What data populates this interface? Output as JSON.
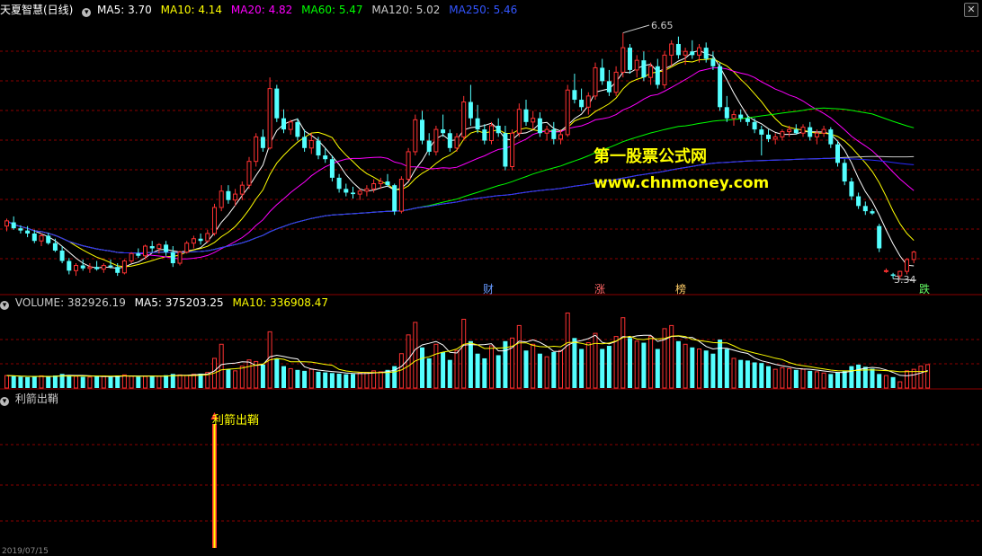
{
  "header": {
    "title": "天夏智慧(日线)",
    "ma_items": [
      {
        "label": "MA5: 3.70",
        "color": "#ffffff"
      },
      {
        "label": "MA10: 4.14",
        "color": "#ffff00"
      },
      {
        "label": "MA20: 4.82",
        "color": "#ff00ff"
      },
      {
        "label": "MA60: 5.47",
        "color": "#00ff00"
      },
      {
        "label": "MA120: 5.02",
        "color": "#cccccc"
      },
      {
        "label": "MA250: 5.46",
        "color": "#0000ff"
      }
    ]
  },
  "volume_header": {
    "items": [
      {
        "label": "VOLUME: 382926.19",
        "color": "#cccccc"
      },
      {
        "label": "MA5: 375203.25",
        "color": "#ffffff"
      },
      {
        "label": "MA10: 336908.47",
        "color": "#ffff00"
      }
    ]
  },
  "indicator_header": {
    "name": "利箭出鞘"
  },
  "watermark": {
    "line1": "第一股票公式网",
    "line2": "www.chnmoney.com"
  },
  "events": [
    {
      "label": "财",
      "color": "#6699ff"
    },
    {
      "label": "涨",
      "color": "#ff6666"
    },
    {
      "label": "榜",
      "color": "#ffcc66"
    },
    {
      "label": "跌",
      "color": "#66ff66"
    }
  ],
  "price_labels": {
    "high": "6.65",
    "low": "3.34"
  },
  "signal": {
    "label": "利箭出鞘"
  },
  "bottom_date": "2019/07/15",
  "chart_data": {
    "type": "candlestick",
    "colors": {
      "up": "#ff3232",
      "down": "#54ffff",
      "grid": "#8b0000",
      "signal": "#ffff00"
    },
    "ohlc": [
      [
        4.05,
        4.15,
        3.98,
        4.12
      ],
      [
        4.1,
        4.18,
        4.0,
        4.02
      ],
      [
        4.02,
        4.06,
        3.95,
        3.99
      ],
      [
        3.99,
        4.05,
        3.9,
        3.95
      ],
      [
        3.95,
        4.0,
        3.82,
        3.85
      ],
      [
        3.85,
        3.95,
        3.78,
        3.92
      ],
      [
        3.92,
        3.96,
        3.8,
        3.82
      ],
      [
        3.82,
        3.88,
        3.7,
        3.72
      ],
      [
        3.72,
        3.78,
        3.55,
        3.58
      ],
      [
        3.58,
        3.62,
        3.4,
        3.45
      ],
      [
        3.45,
        3.55,
        3.38,
        3.52
      ],
      [
        3.52,
        3.6,
        3.45,
        3.48
      ],
      [
        3.48,
        3.55,
        3.42,
        3.5
      ],
      [
        3.5,
        3.58,
        3.45,
        3.47
      ],
      [
        3.47,
        3.55,
        3.42,
        3.52
      ],
      [
        3.52,
        3.6,
        3.48,
        3.5
      ],
      [
        3.5,
        3.55,
        3.38,
        3.42
      ],
      [
        3.42,
        3.6,
        3.4,
        3.58
      ],
      [
        3.58,
        3.7,
        3.55,
        3.68
      ],
      [
        3.68,
        3.75,
        3.62,
        3.65
      ],
      [
        3.65,
        3.8,
        3.6,
        3.78
      ],
      [
        3.78,
        3.85,
        3.7,
        3.75
      ],
      [
        3.75,
        3.82,
        3.68,
        3.8
      ],
      [
        3.8,
        3.85,
        3.65,
        3.7
      ],
      [
        3.7,
        3.78,
        3.5,
        3.55
      ],
      [
        3.55,
        3.72,
        3.52,
        3.7
      ],
      [
        3.7,
        3.85,
        3.68,
        3.82
      ],
      [
        3.82,
        3.92,
        3.75,
        3.88
      ],
      [
        3.88,
        3.95,
        3.8,
        3.85
      ],
      [
        3.85,
        4.0,
        3.82,
        3.95
      ],
      [
        3.95,
        4.35,
        3.92,
        4.3
      ],
      [
        4.3,
        4.6,
        4.25,
        4.52
      ],
      [
        4.52,
        4.6,
        4.35,
        4.4
      ],
      [
        4.4,
        4.55,
        4.32,
        4.48
      ],
      [
        4.48,
        4.65,
        4.4,
        4.6
      ],
      [
        4.6,
        4.98,
        4.55,
        4.92
      ],
      [
        4.92,
        5.3,
        4.85,
        5.25
      ],
      [
        5.25,
        5.35,
        5.05,
        5.1
      ],
      [
        5.1,
        6.05,
        5.08,
        5.9
      ],
      [
        5.9,
        5.95,
        5.45,
        5.5
      ],
      [
        5.5,
        5.62,
        5.3,
        5.35
      ],
      [
        5.35,
        5.48,
        5.28,
        5.45
      ],
      [
        5.45,
        5.5,
        5.2,
        5.25
      ],
      [
        5.25,
        5.35,
        5.05,
        5.1
      ],
      [
        5.1,
        5.3,
        5.02,
        5.2
      ],
      [
        5.2,
        5.25,
        4.95,
        5.0
      ],
      [
        5.0,
        5.1,
        4.9,
        4.95
      ],
      [
        4.95,
        5.0,
        4.65,
        4.7
      ],
      [
        4.7,
        4.75,
        4.5,
        4.55
      ],
      [
        4.55,
        4.62,
        4.45,
        4.5
      ],
      [
        4.5,
        4.58,
        4.42,
        4.48
      ],
      [
        4.48,
        4.55,
        4.4,
        4.52
      ],
      [
        4.52,
        4.6,
        4.45,
        4.55
      ],
      [
        4.55,
        4.68,
        4.5,
        4.62
      ],
      [
        4.62,
        4.7,
        4.55,
        4.65
      ],
      [
        4.65,
        4.75,
        4.58,
        4.6
      ],
      [
        4.6,
        4.62,
        4.2,
        4.25
      ],
      [
        4.25,
        4.72,
        4.22,
        4.68
      ],
      [
        4.68,
        5.1,
        4.65,
        5.05
      ],
      [
        5.05,
        5.55,
        5.0,
        5.48
      ],
      [
        5.48,
        5.6,
        5.15,
        5.2
      ],
      [
        5.2,
        5.3,
        5.0,
        5.05
      ],
      [
        5.05,
        5.4,
        5.0,
        5.35
      ],
      [
        5.35,
        5.55,
        5.25,
        5.3
      ],
      [
        5.3,
        5.35,
        5.05,
        5.1
      ],
      [
        5.1,
        5.3,
        5.05,
        5.25
      ],
      [
        5.25,
        5.8,
        5.2,
        5.72
      ],
      [
        5.72,
        5.95,
        5.4,
        5.5
      ],
      [
        5.5,
        5.68,
        5.3,
        5.35
      ],
      [
        5.35,
        5.42,
        5.15,
        5.2
      ],
      [
        5.2,
        5.45,
        5.15,
        5.4
      ],
      [
        5.4,
        5.5,
        5.25,
        5.3
      ],
      [
        5.3,
        5.4,
        4.8,
        4.85
      ],
      [
        4.85,
        5.35,
        4.8,
        5.3
      ],
      [
        5.3,
        5.7,
        5.25,
        5.62
      ],
      [
        5.62,
        5.75,
        5.4,
        5.45
      ],
      [
        5.45,
        5.6,
        5.35,
        5.5
      ],
      [
        5.5,
        5.58,
        5.25,
        5.3
      ],
      [
        5.3,
        5.4,
        5.2,
        5.35
      ],
      [
        5.35,
        5.45,
        5.15,
        5.22
      ],
      [
        5.22,
        5.35,
        5.15,
        5.28
      ],
      [
        5.28,
        5.95,
        5.25,
        5.88
      ],
      [
        5.88,
        6.1,
        5.7,
        5.75
      ],
      [
        5.75,
        5.9,
        5.6,
        5.65
      ],
      [
        5.65,
        5.85,
        5.55,
        5.8
      ],
      [
        5.8,
        6.25,
        5.75,
        6.18
      ],
      [
        6.18,
        6.3,
        5.95,
        6.0
      ],
      [
        6.0,
        6.15,
        5.8,
        5.85
      ],
      [
        5.85,
        6.2,
        5.8,
        6.12
      ],
      [
        6.12,
        6.65,
        6.05,
        6.45
      ],
      [
        6.45,
        6.5,
        6.1,
        6.15
      ],
      [
        6.15,
        6.35,
        6.05,
        6.28
      ],
      [
        6.28,
        6.4,
        6.0,
        6.05
      ],
      [
        6.05,
        6.25,
        5.95,
        6.2
      ],
      [
        6.2,
        6.3,
        5.9,
        5.95
      ],
      [
        5.95,
        6.4,
        5.9,
        6.35
      ],
      [
        6.35,
        6.55,
        6.2,
        6.5
      ],
      [
        6.5,
        6.6,
        6.3,
        6.35
      ],
      [
        6.35,
        6.45,
        6.22,
        6.4
      ],
      [
        6.4,
        6.55,
        6.3,
        6.35
      ],
      [
        6.35,
        6.5,
        6.25,
        6.45
      ],
      [
        6.45,
        6.52,
        6.25,
        6.3
      ],
      [
        6.3,
        6.4,
        6.15,
        6.2
      ],
      [
        6.2,
        6.25,
        5.6,
        5.65
      ],
      [
        5.65,
        5.8,
        5.45,
        5.5
      ],
      [
        5.5,
        5.6,
        5.4,
        5.55
      ],
      [
        5.55,
        5.62,
        5.45,
        5.5
      ],
      [
        5.5,
        5.55,
        5.4,
        5.45
      ],
      [
        5.45,
        5.5,
        5.3,
        5.35
      ],
      [
        5.35,
        5.4,
        5.0,
        5.28
      ],
      [
        5.28,
        5.35,
        5.18,
        5.22
      ],
      [
        5.22,
        5.3,
        5.15,
        5.25
      ],
      [
        5.25,
        5.35,
        5.2,
        5.32
      ],
      [
        5.32,
        5.4,
        5.25,
        5.35
      ],
      [
        5.35,
        5.42,
        5.28,
        5.3
      ],
      [
        5.3,
        5.42,
        5.25,
        5.38
      ],
      [
        5.38,
        5.45,
        5.2,
        5.25
      ],
      [
        5.25,
        5.35,
        5.15,
        5.3
      ],
      [
        5.3,
        5.4,
        5.25,
        5.35
      ],
      [
        5.35,
        5.38,
        5.1,
        5.15
      ],
      [
        5.15,
        5.2,
        4.85,
        4.9
      ],
      [
        4.9,
        4.95,
        4.6,
        4.65
      ],
      [
        4.65,
        4.7,
        4.4,
        4.45
      ],
      [
        4.45,
        4.5,
        4.28,
        4.32
      ],
      [
        4.32,
        4.38,
        4.2,
        4.25
      ],
      [
        4.25,
        4.28,
        4.2,
        4.22
      ],
      [
        4.05,
        4.08,
        3.7,
        3.75
      ],
      [
        3.45,
        3.48,
        3.42,
        3.45
      ],
      [
        3.4,
        3.42,
        3.34,
        3.38
      ],
      [
        3.38,
        3.45,
        3.34,
        3.44
      ],
      [
        3.44,
        3.62,
        3.4,
        3.6
      ],
      [
        3.6,
        3.72,
        3.55,
        3.7
      ]
    ],
    "volume": [
      40,
      38,
      36,
      35,
      37,
      39,
      36,
      40,
      45,
      42,
      38,
      36,
      35,
      37,
      38,
      36,
      40,
      42,
      38,
      36,
      37,
      39,
      38,
      41,
      45,
      42,
      40,
      44,
      46,
      50,
      95,
      140,
      60,
      55,
      70,
      90,
      85,
      75,
      180,
      95,
      70,
      62,
      58,
      55,
      60,
      52,
      50,
      48,
      46,
      44,
      45,
      48,
      50,
      55,
      52,
      58,
      70,
      110,
      170,
      210,
      130,
      95,
      140,
      115,
      90,
      120,
      220,
      150,
      110,
      95,
      135,
      105,
      150,
      160,
      200,
      120,
      140,
      110,
      100,
      115,
      120,
      240,
      160,
      125,
      145,
      175,
      125,
      135,
      165,
      225,
      160,
      150,
      145,
      165,
      125,
      190,
      200,
      150,
      140,
      130,
      125,
      120,
      110,
      155,
      125,
      95,
      90,
      88,
      82,
      80,
      70,
      60,
      65,
      62,
      58,
      60,
      55,
      52,
      48,
      45,
      50,
      55,
      70,
      75,
      68,
      62,
      45,
      40,
      35,
      20,
      55,
      60,
      70,
      75
    ],
    "price_range": [
      3.2,
      6.85
    ],
    "volume_max": 250,
    "signal_bar_index": 30,
    "event_indices": [
      71,
      88,
      101,
      135
    ]
  }
}
